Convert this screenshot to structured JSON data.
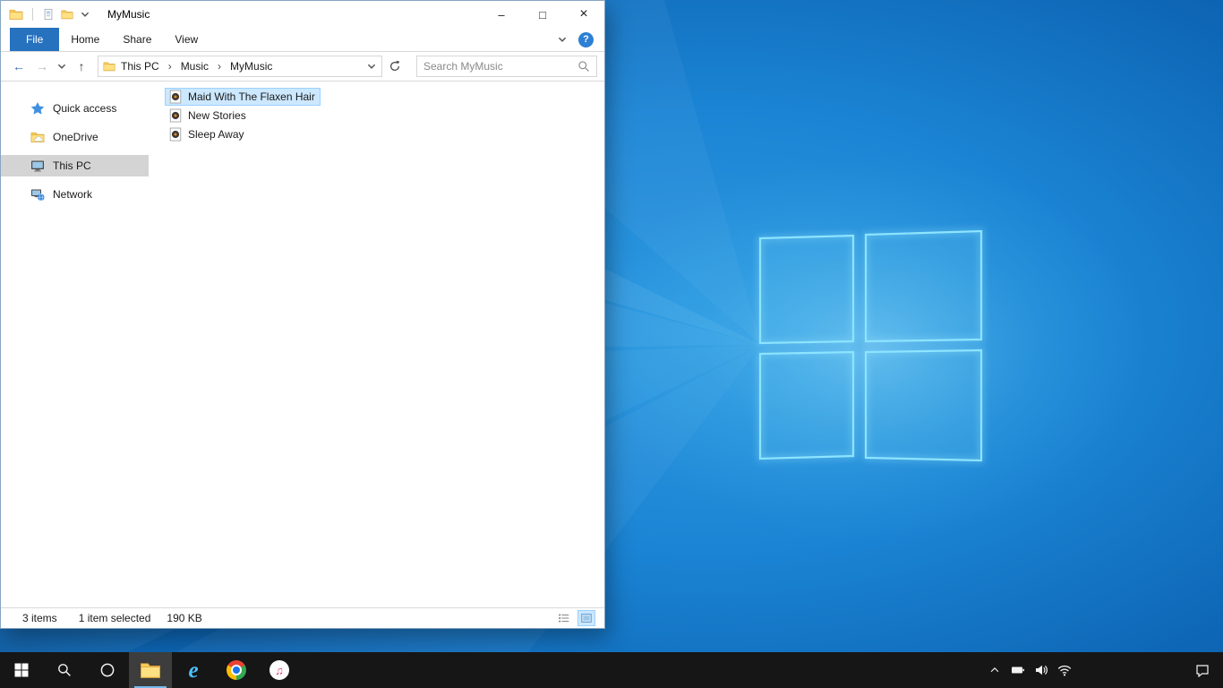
{
  "explorer": {
    "title": "MyMusic",
    "window_controls": {
      "minimize": "–",
      "maximize": "□",
      "close": "×"
    },
    "ribbon": {
      "tabs": [
        {
          "label": "File",
          "active": true
        },
        {
          "label": "Home",
          "active": false
        },
        {
          "label": "Share",
          "active": false
        },
        {
          "label": "View",
          "active": false
        }
      ],
      "help_glyph": "?"
    },
    "nav": {
      "back": "←",
      "forward": "→",
      "up": "↑"
    },
    "address": {
      "crumbs": [
        "This PC",
        "Music",
        "MyMusic"
      ],
      "separator": "›"
    },
    "search": {
      "placeholder": "Search MyMusic"
    },
    "sidebar": {
      "items": [
        {
          "label": "Quick access",
          "icon": "star-icon",
          "selected": false
        },
        {
          "label": "OneDrive",
          "icon": "onedrive-folder-icon",
          "selected": false
        },
        {
          "label": "This PC",
          "icon": "computer-icon",
          "selected": true
        },
        {
          "label": "Network",
          "icon": "network-icon",
          "selected": false
        }
      ]
    },
    "files": [
      {
        "name": "Maid With The Flaxen Hair",
        "icon": "media-file-icon",
        "selected": true
      },
      {
        "name": "New Stories",
        "icon": "media-file-icon",
        "selected": false
      },
      {
        "name": "Sleep Away",
        "icon": "media-file-icon",
        "selected": false
      }
    ],
    "status": {
      "count": "3 items",
      "selected": "1 item selected",
      "size": "190 KB"
    }
  },
  "taskbar": {
    "ie_glyph": "e",
    "itunes_glyph": "♫",
    "apps": [
      "start",
      "search",
      "cortana",
      "file-explorer",
      "internet-explorer",
      "chrome",
      "itunes"
    ],
    "tray": [
      "hidden-icons",
      "battery",
      "volume",
      "wifi",
      "action-center"
    ],
    "accent": "#76b9ed"
  }
}
